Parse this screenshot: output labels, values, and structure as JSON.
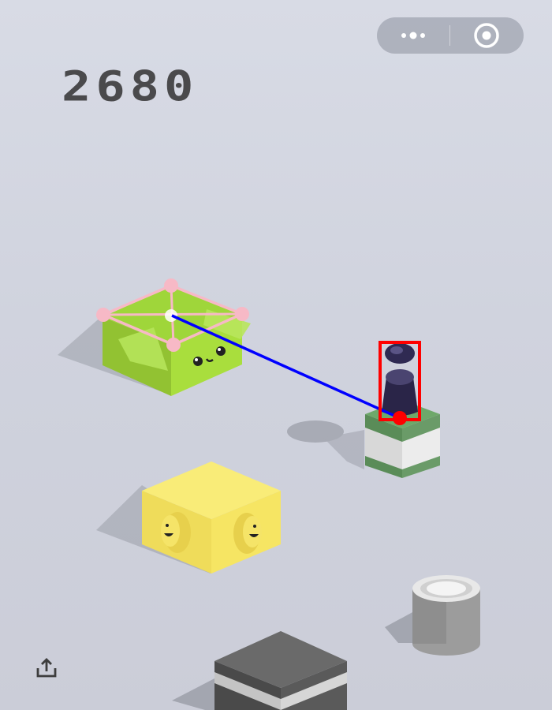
{
  "game": {
    "score": "2680"
  },
  "capsule": {
    "more_icon": "more-dots-icon",
    "close_icon": "target-circle-icon"
  },
  "share": {
    "icon": "share-upload-icon"
  },
  "colors": {
    "background": "#d4d7e1",
    "score_text": "#4a4a4c",
    "green_box_top": "#9fd63a",
    "green_box_front": "#a8dd3c",
    "yellow_box": "#f4e25e",
    "player": "#2a2548",
    "target_keypoints": "#f7b9c6",
    "trajectory_line": "#0000ff",
    "player_bbox": "#ff0000"
  },
  "annotations": {
    "target_keypoints_count": 5,
    "player_bbox_visible": true,
    "trajectory_visible": true
  }
}
